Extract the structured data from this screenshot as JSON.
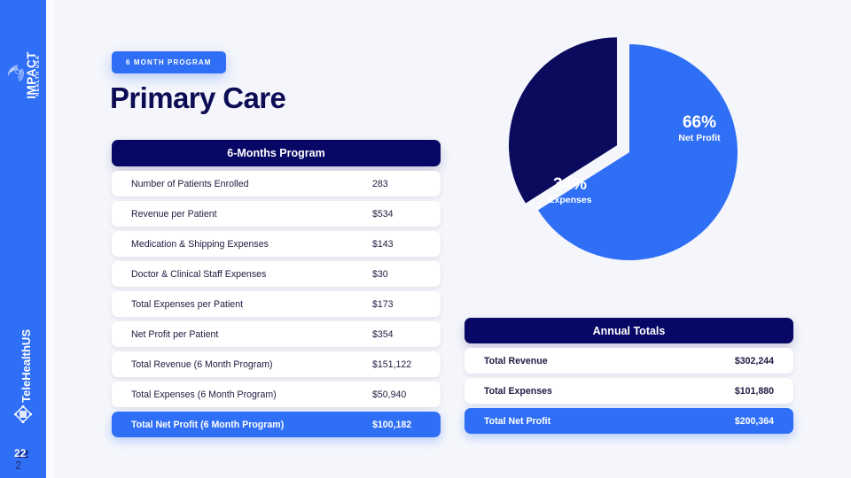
{
  "sidebar": {
    "brand_name": "IMPACT",
    "brand_sub": "HEALTH USA",
    "brand_icon": "radial-burst-icon",
    "telehealth_label": "TeleHealthUS",
    "telehealth_icon": "diamond-node-icon",
    "page_number": "22",
    "page_number_secondary": "2"
  },
  "header": {
    "badge": "6 MONTH PROGRAM",
    "title": "Primary Care"
  },
  "main_table": {
    "header": "6-Months Program",
    "rows": [
      {
        "label": "Number of Patients Enrolled",
        "value": "283",
        "highlight": false
      },
      {
        "label": "Revenue per Patient",
        "value": "$534",
        "highlight": false
      },
      {
        "label": "Medication & Shipping Expenses",
        "value": "$143",
        "highlight": false
      },
      {
        "label": "Doctor & Clinical Staff Expenses",
        "value": "$30",
        "highlight": false
      },
      {
        "label": "Total Expenses per Patient",
        "value": "$173",
        "highlight": false
      },
      {
        "label": "Net Profit per Patient",
        "value": "$354",
        "highlight": false
      },
      {
        "label": "Total Revenue (6 Month Program)",
        "value": "$151,122",
        "highlight": false
      },
      {
        "label": "Total Expenses (6 Month Program)",
        "value": "$50,940",
        "highlight": false
      },
      {
        "label": "Total Net Profit (6 Month Program)",
        "value": "$100,182",
        "highlight": true
      }
    ]
  },
  "annual_table": {
    "header": "Annual Totals",
    "rows": [
      {
        "label": "Total Revenue",
        "value": "$302,244",
        "highlight": false
      },
      {
        "label": "Total Expenses",
        "value": "$101,880",
        "highlight": false
      },
      {
        "label": "Total Net Profit",
        "value": "$200,364",
        "highlight": true
      }
    ]
  },
  "chart_data": {
    "type": "pie",
    "title": "",
    "categories": [
      "Net Profit",
      "Expenses"
    ],
    "values": [
      66,
      34
    ],
    "labels": [
      "66%",
      "34%"
    ],
    "colors": [
      "#2f6ff5",
      "#0b0b5e"
    ],
    "exploded_slice": "Expenses",
    "legend": "inside-slices",
    "unit": "%"
  },
  "colors": {
    "accent_blue": "#2f6ff5",
    "dark_navy": "#070766",
    "page_background": "#f5f6fb",
    "row_background": "#ffffff",
    "text_dark": "#1c1c42",
    "title_navy": "#0d0d55"
  }
}
